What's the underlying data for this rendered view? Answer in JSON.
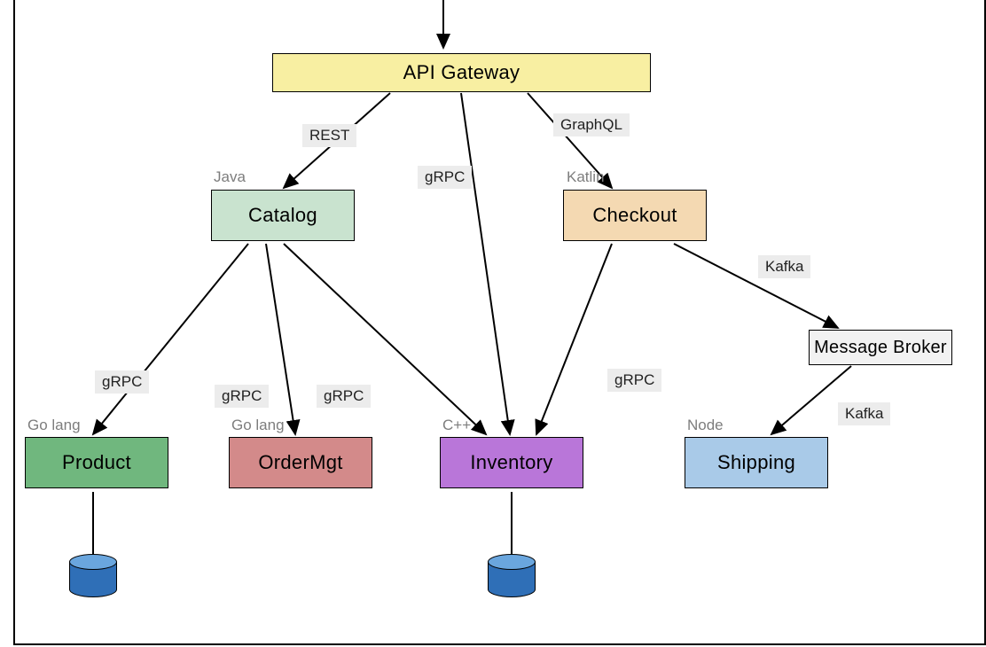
{
  "diagram": {
    "nodes": {
      "api_gateway": {
        "label": "API Gateway"
      },
      "catalog": {
        "label": "Catalog",
        "lang": "Java"
      },
      "checkout": {
        "label": "Checkout",
        "lang": "Katlin"
      },
      "message_broker": {
        "label": "Message Broker"
      },
      "product": {
        "label": "Product",
        "lang": "Go lang"
      },
      "ordermgt": {
        "label": "OrderMgt",
        "lang": "Go lang"
      },
      "inventory": {
        "label": "Inventory",
        "lang": "C++"
      },
      "shipping": {
        "label": "Shipping",
        "lang": "Node"
      }
    },
    "edges": {
      "entry_to_gateway": {
        "protocol": null
      },
      "gateway_to_catalog": {
        "protocol": "REST"
      },
      "gateway_to_inventory": {
        "protocol": "gRPC"
      },
      "gateway_to_checkout": {
        "protocol": "GraphQL"
      },
      "catalog_to_product": {
        "protocol": "gRPC"
      },
      "catalog_to_ordermgt": {
        "protocol": "gRPC"
      },
      "catalog_to_inventory": {
        "protocol": "gRPC"
      },
      "checkout_to_inventory": {
        "protocol": "gRPC"
      },
      "checkout_to_broker": {
        "protocol": "Kafka"
      },
      "broker_to_shipping": {
        "protocol": "Kafka"
      }
    },
    "datastores": {
      "product_db": true,
      "inventory_db": true
    }
  }
}
